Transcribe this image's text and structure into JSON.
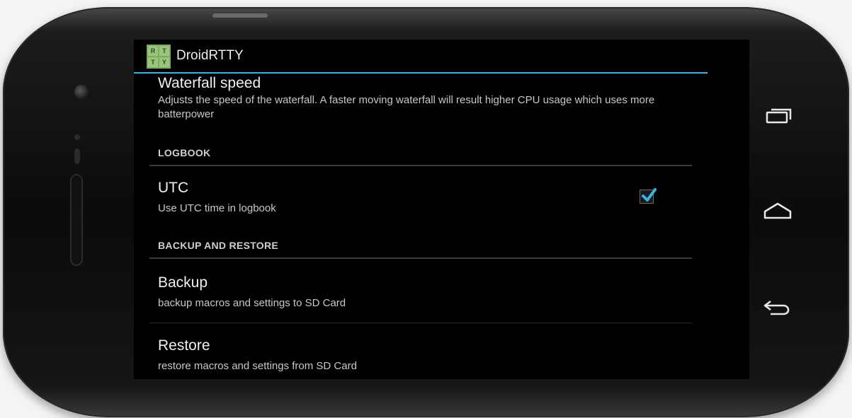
{
  "app": {
    "title": "DroidRTTY",
    "icon_letters": [
      "R",
      "T",
      "T",
      "Y"
    ]
  },
  "preferences": {
    "waterfall": {
      "title": "Waterfall speed",
      "summary": "Adjusts the speed of the waterfall. A faster moving waterfall will result higher CPU usage which uses more batterpower"
    },
    "logbook_category": "LOGBOOK",
    "utc": {
      "title": "UTC",
      "summary": "Use UTC time in logbook",
      "checked": true
    },
    "backup_category": "BACKUP AND RESTORE",
    "backup": {
      "title": "Backup",
      "summary": "backup macros and settings to SD Card"
    },
    "restore": {
      "title": "Restore",
      "summary": "restore macros and settings from SD Card"
    }
  },
  "navigation": {
    "recent": "recent-apps-icon",
    "home": "home-icon",
    "back": "back-icon"
  },
  "colors": {
    "accent": "#33b5e5",
    "background": "#000000",
    "text": "#f0f0f0"
  }
}
